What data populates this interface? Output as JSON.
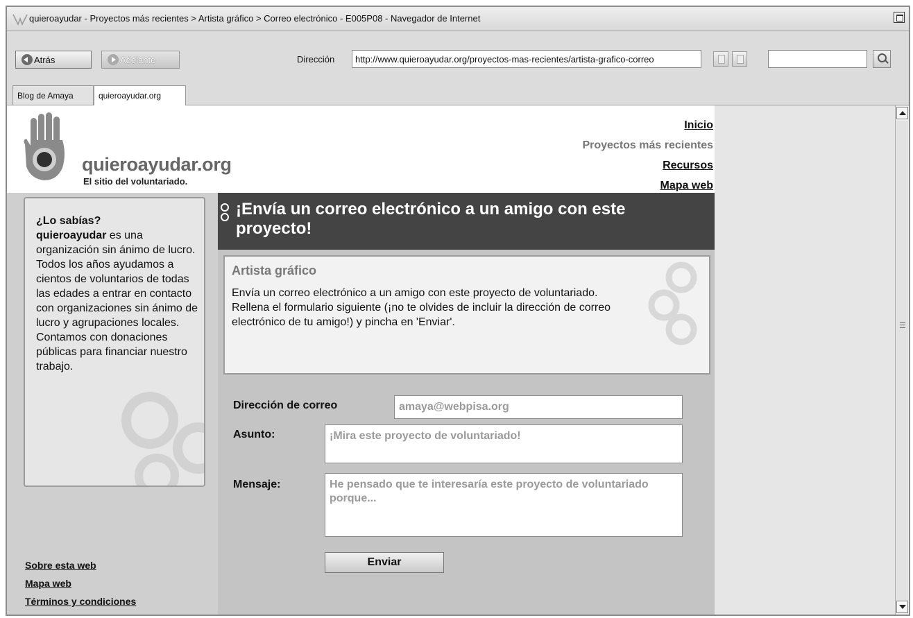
{
  "window": {
    "title": "quieroayudar - Proyectos más recientes > Artista gráfico > Correo electrónico - E005P08 - Navegador de Internet"
  },
  "toolbar": {
    "back_label": "Atrás",
    "forward_label": "Adelante",
    "address_label": "Dirección",
    "address_value": "http://www.quieroayudar.org/proyectos-mas-recientes/artista-grafico-correo",
    "search_value": ""
  },
  "tabs": [
    {
      "label": "Blog de Amaya",
      "active": false
    },
    {
      "label": "quieroayudar.org",
      "active": true
    }
  ],
  "site": {
    "logo_name": "quieroayudar.org",
    "tagline": "El sitio del voluntariado.",
    "nav": [
      {
        "label": "Inicio",
        "current": false
      },
      {
        "label": "Proyectos más recientes",
        "current": true
      },
      {
        "label": "Recursos",
        "current": false
      },
      {
        "label": "Mapa web",
        "current": false
      }
    ]
  },
  "sidebar": {
    "heading": "¿Lo sabías?",
    "org_name": "quieroayudar",
    "body": " es una organización sin ánimo de lucro. Todos los años ayudamos a cientos de voluntarios de todas las edades a entrar en contacto con organizaciones sin ánimo de lucro y agrupaciones locales. Contamos con donaciones públicas para financiar nuestro trabajo."
  },
  "footer": {
    "links": [
      "Sobre esta web",
      "Mapa web",
      "Términos y condiciones"
    ]
  },
  "main": {
    "banner_title": "¡Envía un correo electrónico a un amigo con este proyecto!",
    "project_title": "Artista gráfico",
    "project_desc_1": "Envía un correo electrónico a un amigo con este proyecto de voluntariado.",
    "project_desc_2": "Rellena el formulario siguiente (¡no te olvides de incluir la dirección de correo electrónico de tu amigo!) y pincha en 'Enviar'."
  },
  "form": {
    "email_label": "Dirección de correo",
    "email_value": "amaya@webpisa.org",
    "subject_label": "Asunto:",
    "subject_value": "¡Mira este proyecto de voluntariado!",
    "message_label": "Mensaje:",
    "message_value": "He pensado que te interesaría este proyecto de voluntariado porque...",
    "send_label": "Enviar"
  }
}
